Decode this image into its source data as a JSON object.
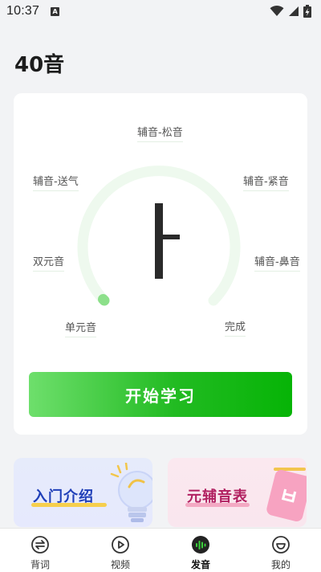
{
  "status_bar": {
    "time": "10:37",
    "notification_icon": "a-icon",
    "icons": [
      "wifi-icon",
      "signal-icon",
      "battery-charging-icon"
    ]
  },
  "page": {
    "title": "40音"
  },
  "main_card": {
    "center_letter": "ㅏ",
    "progress_fraction": 0.03,
    "labels": {
      "top": "辅音-松音",
      "upper_left": "辅音-送气",
      "upper_right": "辅音-紧音",
      "mid_left": "双元音",
      "mid_right": "辅音-鼻音",
      "lower_left": "单元音",
      "lower_right": "完成"
    },
    "start_button": "开始学习"
  },
  "features": [
    {
      "label": "入门介绍",
      "icon": "lightbulb-icon"
    },
    {
      "label": "元辅音表",
      "icon": "chart-icon"
    }
  ],
  "bottom_nav": {
    "items": [
      {
        "label": "背词",
        "icon": "swap-icon"
      },
      {
        "label": "视频",
        "icon": "play-icon"
      },
      {
        "label": "发音",
        "icon": "soundwave-icon"
      },
      {
        "label": "我的",
        "icon": "smile-icon"
      }
    ],
    "active_index": 2
  },
  "colors": {
    "accent": "#1db31d",
    "track": "#eef9ee",
    "progress": "#8ce08a"
  }
}
